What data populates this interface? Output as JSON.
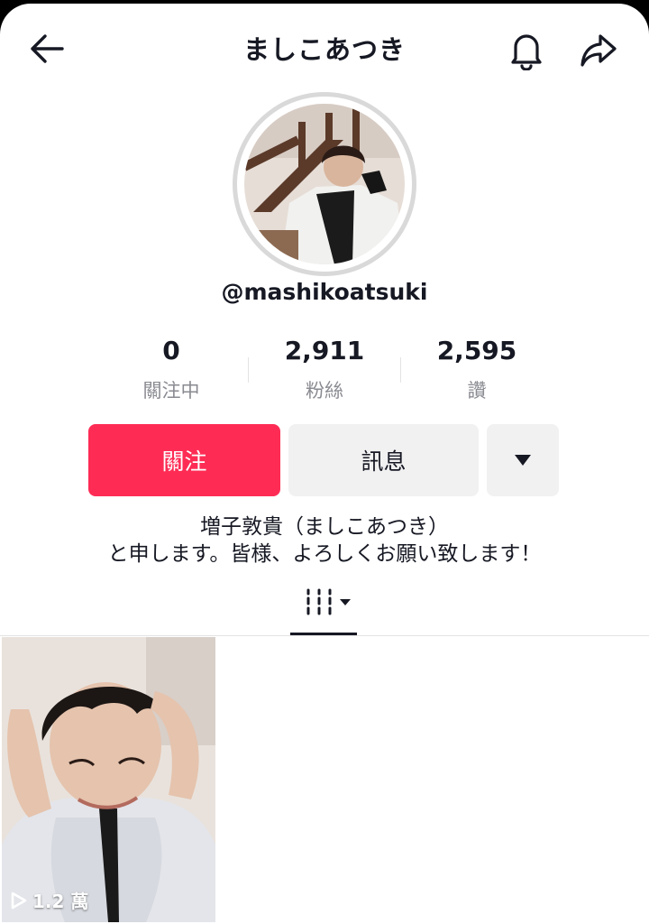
{
  "header": {
    "title": "ましこあつき",
    "back_icon": "arrow-left-icon",
    "bell_icon": "bell-icon",
    "share_icon": "share-icon"
  },
  "profile": {
    "avatar_icon": "avatar-photo",
    "username": "@mashikoatsuki"
  },
  "stats": [
    {
      "value": "0",
      "label": "關注中"
    },
    {
      "value": "2,911",
      "label": "粉絲"
    },
    {
      "value": "2,595",
      "label": "讚"
    }
  ],
  "actions": {
    "follow_label": "關注",
    "message_label": "訊息",
    "more_icon": "triangle-down-icon"
  },
  "bio": {
    "line1": "増子敦貴（ましこあつき）",
    "line2": "と申します。皆様、よろしくお願い致します！"
  },
  "tabs": {
    "grid_icon": "grid-bars-icon"
  },
  "videos": [
    {
      "views": "1.2 萬"
    }
  ],
  "colors": {
    "accent": "#fe2c55",
    "secondary_button": "#f1f1f2",
    "muted_text": "#8a8b91"
  }
}
